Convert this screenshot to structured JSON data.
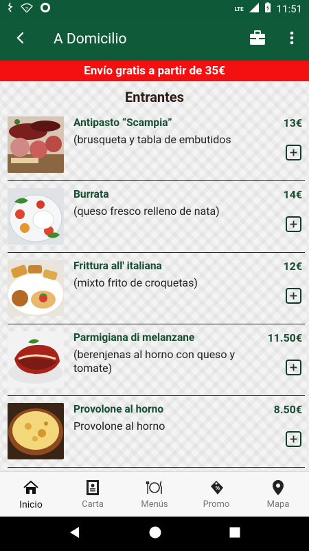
{
  "status_bar": {
    "time": "11:51",
    "network": "LTE"
  },
  "app_bar": {
    "title": "A Domicilio"
  },
  "banner": {
    "text": "Envío gratis a partir de 35€"
  },
  "section": {
    "title": "Entrantes"
  },
  "items": [
    {
      "name": "Antipasto “Scampia”",
      "desc": "(brusqueta y tabla de embutidos",
      "price": "13€"
    },
    {
      "name": "Burrata",
      "desc": "(queso fresco relleno de nata)",
      "price": "14€"
    },
    {
      "name": "Frittura all' italiana",
      "desc": "(mixto frito de croquetas)",
      "price": "12€"
    },
    {
      "name": "Parmigiana di melanzane",
      "desc": "(berenjenas al horno con queso y tomate)",
      "price": "11.50€"
    },
    {
      "name": "Provolone al horno",
      "desc": "Provolone al horno",
      "price": "8.50€"
    }
  ],
  "bottom_nav": [
    {
      "label": "Inicio",
      "icon": "home-icon",
      "active": true
    },
    {
      "label": "Carta",
      "icon": "menu-card-icon",
      "active": false
    },
    {
      "label": "Menús",
      "icon": "plate-cutlery-icon",
      "active": false
    },
    {
      "label": "Promo",
      "icon": "promo-tag-icon",
      "active": false
    },
    {
      "label": "Mapa",
      "icon": "map-pin-icon",
      "active": false
    }
  ],
  "colors": {
    "primary": "#0f5b39",
    "banner": "#f21010",
    "accent_text": "#174d33"
  }
}
